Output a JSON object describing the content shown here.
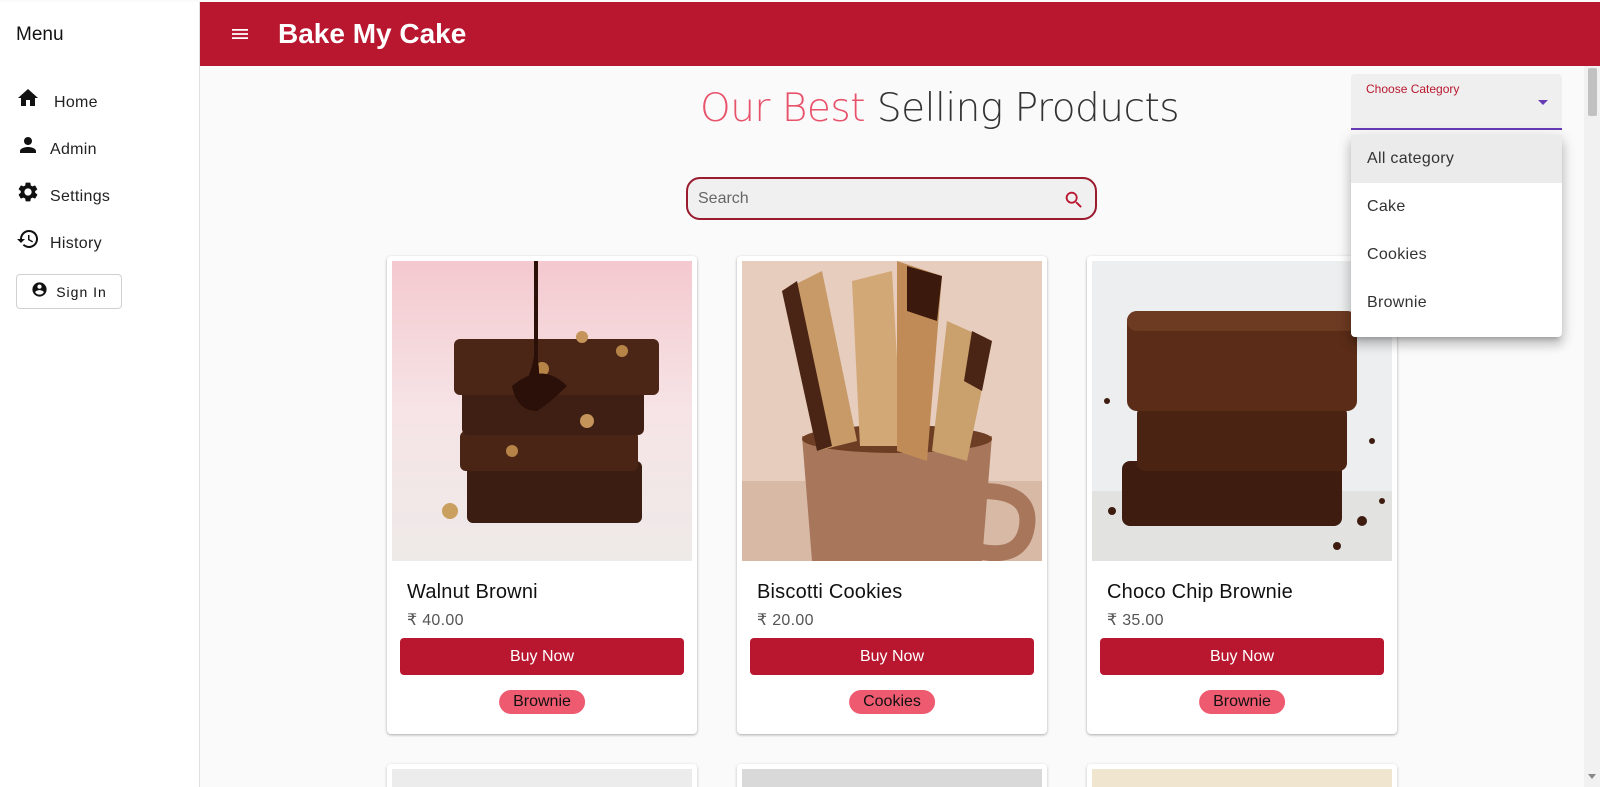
{
  "sidebar": {
    "title": "Menu",
    "items": [
      {
        "label": "Home",
        "icon": "home-icon"
      },
      {
        "label": "Admin",
        "icon": "person-icon"
      },
      {
        "label": "Settings",
        "icon": "gear-icon"
      },
      {
        "label": "History",
        "icon": "history-icon"
      }
    ],
    "signin_label": "Sign In"
  },
  "header": {
    "title": "Bake My Cake",
    "color": "#b9172f"
  },
  "main": {
    "headline_accent": "Our Best",
    "headline_rest": "Selling Products",
    "search_placeholder": "Search",
    "products": [
      {
        "name": "Walnut Browni",
        "price": "₹ 40.00",
        "button": "Buy Now",
        "category": "Brownie"
      },
      {
        "name": "Biscotti Cookies",
        "price": "₹ 20.00",
        "button": "Buy Now",
        "category": "Cookies"
      },
      {
        "name": "Choco Chip Brownie",
        "price": "₹ 35.00",
        "button": "Buy Now",
        "category": "Brownie"
      }
    ]
  },
  "category_select": {
    "label": "Choose Category",
    "options": [
      "All category",
      "Cake",
      "Cookies",
      "Brownie"
    ]
  }
}
